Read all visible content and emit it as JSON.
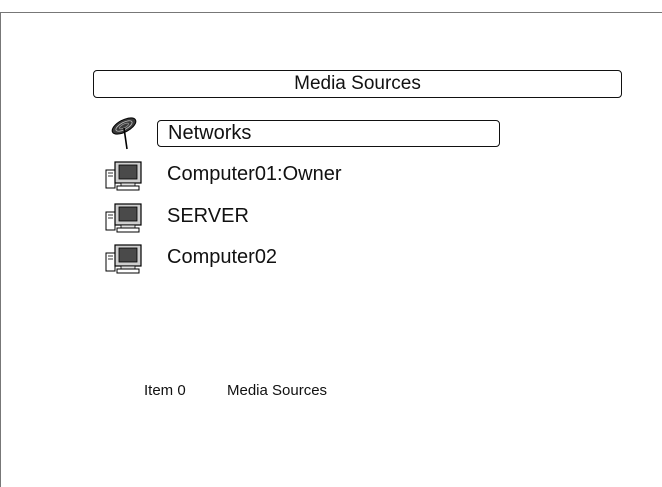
{
  "header": {
    "title": "Media Sources"
  },
  "sources": [
    {
      "label": "Networks",
      "icon": "network-antenna-icon",
      "selected": true
    },
    {
      "label": "Computer01:Owner",
      "icon": "computer-monitor-icon",
      "selected": false
    },
    {
      "label": "SERVER",
      "icon": "computer-monitor-icon",
      "selected": false
    },
    {
      "label": "Computer02",
      "icon": "computer-monitor-icon",
      "selected": false
    }
  ],
  "status": {
    "item": "Item 0",
    "location": "Media Sources"
  }
}
